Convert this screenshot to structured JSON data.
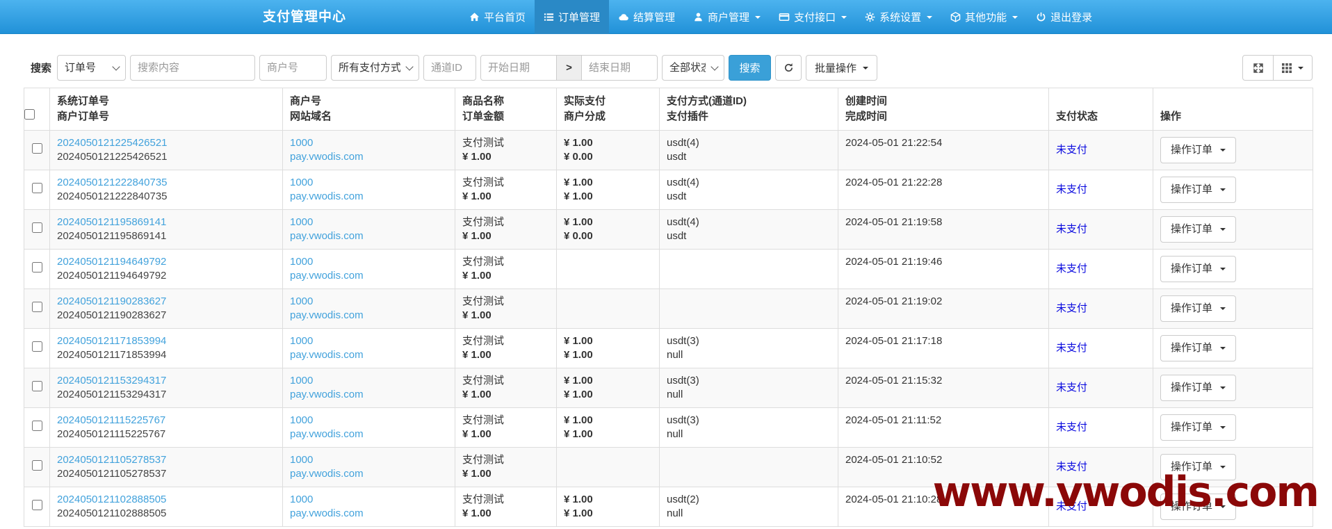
{
  "colors": {
    "accent": "#3aa0d8",
    "link": "#42a2dc",
    "unpaid": "#0b0bdf",
    "watermark": "#8b0808"
  },
  "navbar": {
    "title": "支付管理中心",
    "items": [
      {
        "label": "平台首页",
        "icon": "home-icon",
        "active": false,
        "dropdown": false
      },
      {
        "label": "订单管理",
        "icon": "list-icon",
        "active": true,
        "dropdown": false
      },
      {
        "label": "结算管理",
        "icon": "cloud-icon",
        "active": false,
        "dropdown": false
      },
      {
        "label": "商户管理",
        "icon": "user-icon",
        "active": false,
        "dropdown": true
      },
      {
        "label": "支付接口",
        "icon": "card-icon",
        "active": false,
        "dropdown": true
      },
      {
        "label": "系统设置",
        "icon": "gear-icon",
        "active": false,
        "dropdown": true
      },
      {
        "label": "其他功能",
        "icon": "cube-icon",
        "active": false,
        "dropdown": true
      },
      {
        "label": "退出登录",
        "icon": "power-icon",
        "active": false,
        "dropdown": false
      }
    ]
  },
  "filters": {
    "search_label": "搜索",
    "field_select": "订单号",
    "keyword_placeholder": "搜索内容",
    "merchant_placeholder": "商户号",
    "paytype_select": "所有支付方式",
    "channel_placeholder": "通道ID",
    "start_date_placeholder": "开始日期",
    "date_separator": ">",
    "end_date_placeholder": "结束日期",
    "status_select": "全部状态",
    "search_button": "搜索",
    "batch_button": "批量操作"
  },
  "table": {
    "headers": [
      {
        "line1": "系统订单号",
        "line2": "商户订单号"
      },
      {
        "line1": "商户号",
        "line2": "网站域名"
      },
      {
        "line1": "商品名称",
        "line2": "订单金额"
      },
      {
        "line1": "实际支付",
        "line2": "商户分成"
      },
      {
        "line1": "支付方式(通道ID)",
        "line2": "支付插件"
      },
      {
        "line1": "创建时间",
        "line2": "完成时间"
      },
      {
        "line1": "支付状态",
        "line2": ""
      },
      {
        "line1": "操作",
        "line2": ""
      }
    ],
    "action_label": "操作订单",
    "rows": [
      {
        "sys_no": "2024050121225426521",
        "mch_no": "2024050121225426521",
        "mch_id": "1000",
        "domain": "pay.vwodis.com",
        "product": "支付测试",
        "amount": "¥ 1.00",
        "paid": "¥ 1.00",
        "share": "¥ 0.00",
        "paytype": "usdt(4)",
        "plugin": "usdt",
        "created": "2024-05-01 21:22:54",
        "completed": "",
        "status": "未支付"
      },
      {
        "sys_no": "2024050121222840735",
        "mch_no": "2024050121222840735",
        "mch_id": "1000",
        "domain": "pay.vwodis.com",
        "product": "支付测试",
        "amount": "¥ 1.00",
        "paid": "¥ 1.00",
        "share": "¥ 1.00",
        "paytype": "usdt(4)",
        "plugin": "usdt",
        "created": "2024-05-01 21:22:28",
        "completed": "",
        "status": "未支付"
      },
      {
        "sys_no": "2024050121195869141",
        "mch_no": "2024050121195869141",
        "mch_id": "1000",
        "domain": "pay.vwodis.com",
        "product": "支付测试",
        "amount": "¥ 1.00",
        "paid": "¥ 1.00",
        "share": "¥ 0.00",
        "paytype": "usdt(4)",
        "plugin": "usdt",
        "created": "2024-05-01 21:19:58",
        "completed": "",
        "status": "未支付"
      },
      {
        "sys_no": "2024050121194649792",
        "mch_no": "2024050121194649792",
        "mch_id": "1000",
        "domain": "pay.vwodis.com",
        "product": "支付测试",
        "amount": "¥ 1.00",
        "paid": "",
        "share": "",
        "paytype": "",
        "plugin": "",
        "created": "2024-05-01 21:19:46",
        "completed": "",
        "status": "未支付"
      },
      {
        "sys_no": "2024050121190283627",
        "mch_no": "2024050121190283627",
        "mch_id": "1000",
        "domain": "pay.vwodis.com",
        "product": "支付测试",
        "amount": "¥ 1.00",
        "paid": "",
        "share": "",
        "paytype": "",
        "plugin": "",
        "created": "2024-05-01 21:19:02",
        "completed": "",
        "status": "未支付"
      },
      {
        "sys_no": "2024050121171853994",
        "mch_no": "2024050121171853994",
        "mch_id": "1000",
        "domain": "pay.vwodis.com",
        "product": "支付测试",
        "amount": "¥ 1.00",
        "paid": "¥ 1.00",
        "share": "¥ 1.00",
        "paytype": "usdt(3)",
        "plugin": "null",
        "created": "2024-05-01 21:17:18",
        "completed": "",
        "status": "未支付"
      },
      {
        "sys_no": "2024050121153294317",
        "mch_no": "2024050121153294317",
        "mch_id": "1000",
        "domain": "pay.vwodis.com",
        "product": "支付测试",
        "amount": "¥ 1.00",
        "paid": "¥ 1.00",
        "share": "¥ 1.00",
        "paytype": "usdt(3)",
        "plugin": "null",
        "created": "2024-05-01 21:15:32",
        "completed": "",
        "status": "未支付"
      },
      {
        "sys_no": "2024050121115225767",
        "mch_no": "2024050121115225767",
        "mch_id": "1000",
        "domain": "pay.vwodis.com",
        "product": "支付测试",
        "amount": "¥ 1.00",
        "paid": "¥ 1.00",
        "share": "¥ 1.00",
        "paytype": "usdt(3)",
        "plugin": "null",
        "created": "2024-05-01 21:11:52",
        "completed": "",
        "status": "未支付"
      },
      {
        "sys_no": "2024050121105278537",
        "mch_no": "2024050121105278537",
        "mch_id": "1000",
        "domain": "pay.vwodis.com",
        "product": "支付测试",
        "amount": "¥ 1.00",
        "paid": "",
        "share": "",
        "paytype": "",
        "plugin": "",
        "created": "2024-05-01 21:10:52",
        "completed": "",
        "status": "未支付"
      },
      {
        "sys_no": "2024050121102888505",
        "mch_no": "2024050121102888505",
        "mch_id": "1000",
        "domain": "pay.vwodis.com",
        "product": "支付测试",
        "amount": "¥ 1.00",
        "paid": "¥ 1.00",
        "share": "¥ 1.00",
        "paytype": "usdt(2)",
        "plugin": "null",
        "created": "2024-05-01 21:10:28",
        "completed": "",
        "status": "未支付"
      }
    ]
  },
  "watermark": "www.vwodis.com"
}
